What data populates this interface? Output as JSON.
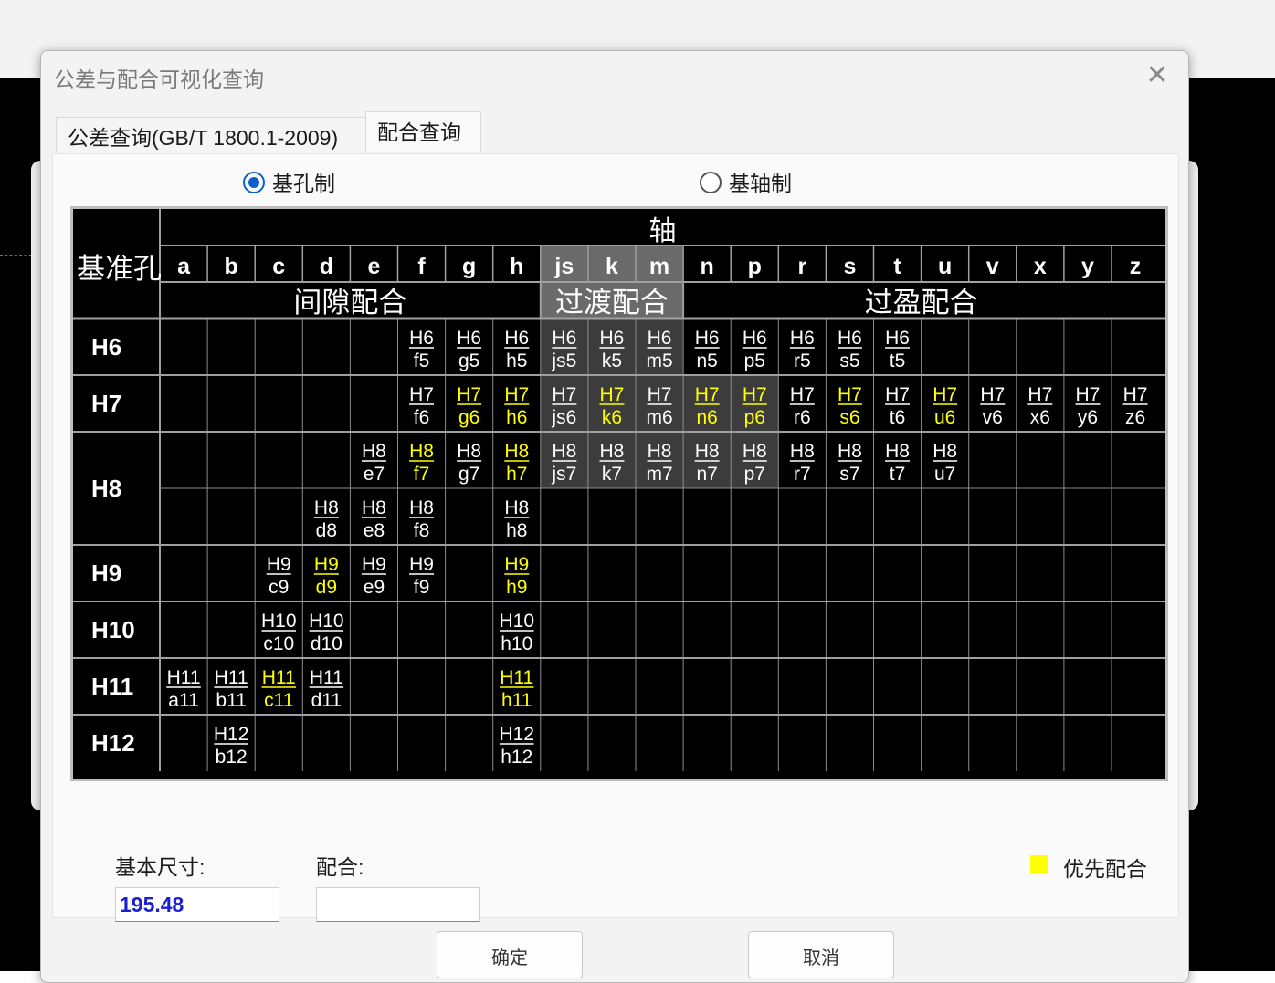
{
  "dialog": {
    "title": "公差与配合可视化查询",
    "close_glyph": "✕"
  },
  "tabs": [
    {
      "label": "公差查询(GB/T 1800.1-2009)"
    },
    {
      "label": "配合查询",
      "active": true
    }
  ],
  "radios": {
    "hole_basis": {
      "label": "基孔制",
      "checked": true
    },
    "shaft_basis": {
      "label": "基轴制",
      "checked": false
    }
  },
  "table": {
    "row_header": "基准孔",
    "axis_title": "轴",
    "groups": [
      {
        "label": "间隙配合",
        "span": 8
      },
      {
        "label": "过渡配合",
        "span": 3
      },
      {
        "label": "过盈配合",
        "span": 10
      }
    ],
    "shafts": [
      "a",
      "b",
      "c",
      "d",
      "e",
      "f",
      "g",
      "h",
      "js",
      "k",
      "m",
      "n",
      "p",
      "r",
      "s",
      "t",
      "u",
      "v",
      "x",
      "y",
      "z"
    ],
    "transition_cols": [
      "js",
      "k",
      "m"
    ],
    "holes": [
      {
        "name": "H6",
        "rows": [
          [
            null,
            null,
            null,
            null,
            null,
            "f5",
            "g5",
            "h5",
            "js5",
            "k5",
            "m5",
            "n5",
            "p5",
            "r5",
            "s5",
            "t5",
            null,
            null,
            null,
            null,
            null
          ]
        ],
        "preferred": []
      },
      {
        "name": "H7",
        "rows": [
          [
            null,
            null,
            null,
            null,
            null,
            "f6",
            "g6",
            "h6",
            "js6",
            "k6",
            "m6",
            "n6",
            "p6",
            "r6",
            "s6",
            "t6",
            "u6",
            "v6",
            "x6",
            "y6",
            "z6"
          ]
        ],
        "preferred": [
          "g6",
          "h6",
          "k6",
          "n6",
          "p6",
          "s6",
          "u6"
        ]
      },
      {
        "name": "H8",
        "rows": [
          [
            null,
            null,
            null,
            null,
            "e7",
            "f7",
            "g7",
            "h7",
            "js7",
            "k7",
            "m7",
            "n7",
            "p7",
            "r7",
            "s7",
            "t7",
            "u7",
            null,
            null,
            null,
            null
          ],
          [
            null,
            null,
            null,
            "d8",
            "e8",
            "f8",
            null,
            "h8",
            null,
            null,
            null,
            null,
            null,
            null,
            null,
            null,
            null,
            null,
            null,
            null,
            null
          ]
        ],
        "preferred": [
          "f7",
          "h7"
        ]
      },
      {
        "name": "H9",
        "rows": [
          [
            null,
            null,
            "c9",
            "d9",
            "e9",
            "f9",
            null,
            "h9",
            null,
            null,
            null,
            null,
            null,
            null,
            null,
            null,
            null,
            null,
            null,
            null,
            null
          ]
        ],
        "preferred": [
          "d9",
          "h9"
        ]
      },
      {
        "name": "H10",
        "rows": [
          [
            null,
            null,
            "c10",
            "d10",
            null,
            null,
            null,
            "h10",
            null,
            null,
            null,
            null,
            null,
            null,
            null,
            null,
            null,
            null,
            null,
            null,
            null
          ]
        ],
        "preferred": []
      },
      {
        "name": "H11",
        "rows": [
          [
            "a11",
            "b11",
            "c11",
            "d11",
            null,
            null,
            null,
            "h11",
            null,
            null,
            null,
            null,
            null,
            null,
            null,
            null,
            null,
            null,
            null,
            null,
            null
          ]
        ],
        "preferred": [
          "c11",
          "h11"
        ]
      },
      {
        "name": "H12",
        "rows": [
          [
            null,
            "b12",
            null,
            null,
            null,
            null,
            null,
            "h12",
            null,
            null,
            null,
            null,
            null,
            null,
            null,
            null,
            null,
            null,
            null,
            null,
            null
          ]
        ],
        "preferred": []
      }
    ],
    "shaded_cells": [
      "H6/js5",
      "H6/k5",
      "H6/m5",
      "H7/js6",
      "H7/k6",
      "H7/m6",
      "H7/n6",
      "H7/p6",
      "H8/js7",
      "H8/k7",
      "H8/m7",
      "H8/n7",
      "H8/p7"
    ],
    "colors": {
      "normal": "#ffffff",
      "preferred": "#ffff00",
      "shaded": "#3c3c3c",
      "header_shaded": "#6a6a6a"
    }
  },
  "form": {
    "size_label": "基本尺寸:",
    "size_value": "195.48",
    "fit_label": "配合:",
    "fit_value": ""
  },
  "legend": {
    "label": "优先配合",
    "color": "#ffff00"
  },
  "buttons": {
    "ok": "确定",
    "cancel": "取消"
  }
}
